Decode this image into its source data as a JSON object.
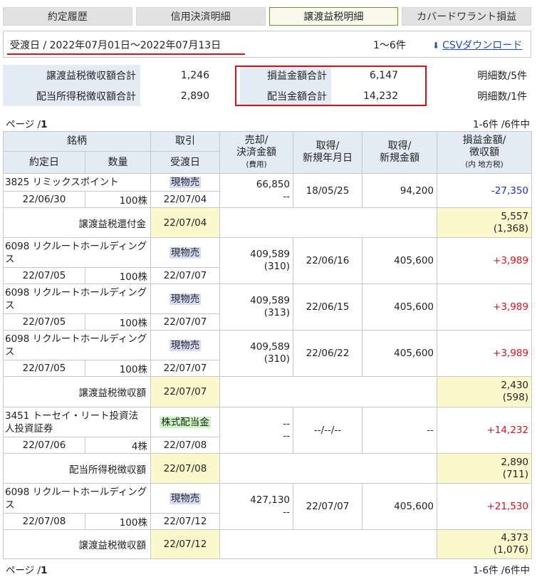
{
  "tabs": [
    {
      "label": "約定履歴"
    },
    {
      "label": "信用決済明細"
    },
    {
      "label": "譲渡益税明細",
      "active": true
    },
    {
      "label": "カバードワラント損益"
    }
  ],
  "range": {
    "text": "受渡日 / 2022年07月01日～2022年07月13日",
    "count": "1～6件",
    "csv_label": "CSVダウンロード"
  },
  "summary": {
    "rows": [
      {
        "left_label": "譲渡益税徴収額合計",
        "left_value": "1,246",
        "mid_label": "損益金額合計",
        "mid_value": "6,147",
        "count": "明細数/5件"
      },
      {
        "left_label": "配当所得税徴収額合計",
        "left_value": "2,890",
        "mid_label": "配当金額合計",
        "mid_value": "14,232",
        "count": "明細数/1件"
      }
    ]
  },
  "pager": {
    "prefix": "ページ /",
    "page": "1",
    "range": "1-6件 /6件中"
  },
  "headers": {
    "stock": "銘柄",
    "trade": "取引",
    "sale_amount_1": "売却/",
    "sale_amount_2": "決済金額",
    "sale_amount_3": "(費用)",
    "acq_date_1": "取得/",
    "acq_date_2": "新規年月日",
    "acq_amount_1": "取得/",
    "acq_amount_2": "新規金額",
    "pl_1": "損益金額/",
    "pl_2": "徴収額",
    "pl_3": "(内 地方税)",
    "contract_date": "約定日",
    "quantity": "数量",
    "delivery_date": "受渡日"
  },
  "rows": [
    {
      "name": "3825 リミックスポイント",
      "trade": "現物売",
      "contract_date": "22/06/30",
      "quantity": "100株",
      "delivery_date": "22/07/04",
      "sale": "66,850",
      "cost": "--",
      "acq_date": "18/05/25",
      "acq_amount": "94,200",
      "pl": "-27,350"
    },
    {
      "tax_label": "譲渡益税還付金",
      "tax_date": "22/07/04",
      "amount": "5,557",
      "local": "(1,368)"
    },
    {
      "name": "6098 リクルートホールディングス",
      "trade": "現物売",
      "contract_date": "22/07/05",
      "quantity": "100株",
      "delivery_date": "22/07/07",
      "sale": "409,589",
      "cost": "(310)",
      "acq_date": "22/06/16",
      "acq_amount": "405,600",
      "pl": "+3,989"
    },
    {
      "name": "6098 リクルートホールディングス",
      "trade": "現物売",
      "contract_date": "22/07/05",
      "quantity": "100株",
      "delivery_date": "22/07/07",
      "sale": "409,589",
      "cost": "(313)",
      "acq_date": "22/06/15",
      "acq_amount": "405,600",
      "pl": "+3,989"
    },
    {
      "name": "6098 リクルートホールディングス",
      "trade": "現物売",
      "contract_date": "22/07/05",
      "quantity": "100株",
      "delivery_date": "22/07/07",
      "sale": "409,589",
      "cost": "(310)",
      "acq_date": "22/06/22",
      "acq_amount": "405,600",
      "pl": "+3,989"
    },
    {
      "tax_label": "譲渡益税徴収額",
      "tax_date": "22/07/07",
      "amount": "2,430",
      "local": "(598)"
    },
    {
      "name": "3451 トーセイ・リート投資法人投資証券",
      "trade": "株式配当金",
      "contract_date": "22/07/06",
      "quantity": "4株",
      "delivery_date": "22/07/08",
      "sale": "--",
      "cost": "--",
      "acq_date": "--/--/--",
      "acq_amount": "--",
      "pl": "+14,232"
    },
    {
      "tax_label": "配当所得税徴収額",
      "tax_date": "22/07/08",
      "amount": "2,890",
      "local": "(711)"
    },
    {
      "name": "6098 リクルートホールディングス",
      "trade": "現物売",
      "contract_date": "22/07/08",
      "quantity": "100株",
      "delivery_date": "22/07/12",
      "sale": "427,130",
      "cost": "--",
      "acq_date": "22/07/07",
      "acq_amount": "405,600",
      "pl": "+21,530"
    },
    {
      "tax_label": "譲渡益税徴収額",
      "tax_date": "22/07/12",
      "amount": "4,373",
      "local": "(1,076)"
    }
  ]
}
